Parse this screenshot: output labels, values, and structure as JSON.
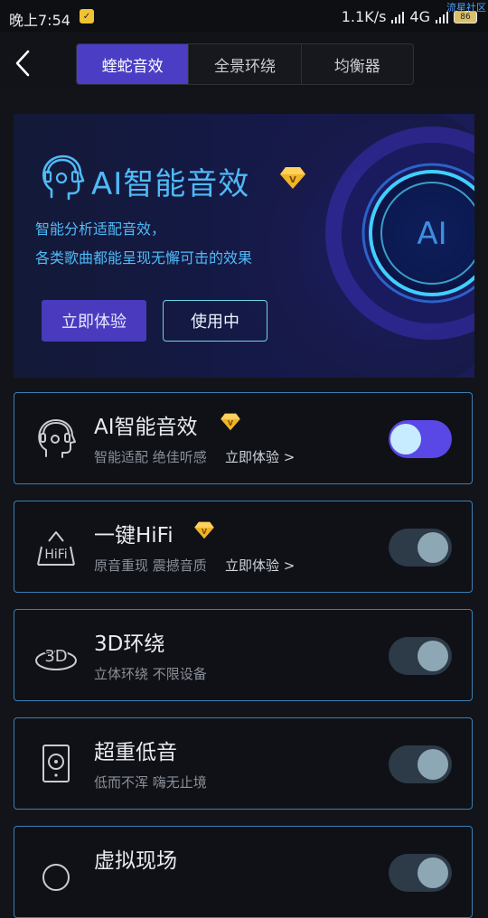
{
  "status_bar": {
    "time": "晚上7:54",
    "network_speed": "1.1K/s",
    "network_type": "4G",
    "battery": "86",
    "watermark": "流星社区"
  },
  "header": {
    "tabs": [
      {
        "label": "蝰蛇音效",
        "active": true
      },
      {
        "label": "全景环绕",
        "active": false
      },
      {
        "label": "均衡器",
        "active": false
      }
    ]
  },
  "banner": {
    "title": "AI智能音效",
    "desc_line1": "智能分析适配音效，",
    "desc_line2": "各类歌曲都能呈现无懈可击的效果",
    "try_button": "立即体验",
    "using_button": "使用中",
    "orb_label": "AI"
  },
  "effects": [
    {
      "title": "AI智能音效",
      "subtitle": "智能适配 绝佳听感",
      "link": "立即体验 >",
      "premium": true,
      "enabled": true,
      "icon": "ai-head-icon"
    },
    {
      "title": "一键HiFi",
      "subtitle": "原音重现 震撼音质",
      "link": "立即体验 >",
      "premium": true,
      "enabled": false,
      "icon": "hifi-icon"
    },
    {
      "title": "3D环绕",
      "subtitle": "立体环绕 不限设备",
      "link": "",
      "premium": false,
      "enabled": false,
      "icon": "3d-surround-icon"
    },
    {
      "title": "超重低音",
      "subtitle": "低而不浑 嗨无止境",
      "link": "",
      "premium": false,
      "enabled": false,
      "icon": "subwoofer-icon"
    },
    {
      "title": "虚拟现场",
      "subtitle": "",
      "link": "",
      "premium": false,
      "enabled": false,
      "icon": "virtual-venue-icon"
    }
  ],
  "colors": {
    "accent_purple": "#4a3bbe",
    "accent_blue": "#4fbaf7",
    "card_border": "#3b7fb4",
    "background": "#121419",
    "premium_gold": "#f0b429"
  }
}
